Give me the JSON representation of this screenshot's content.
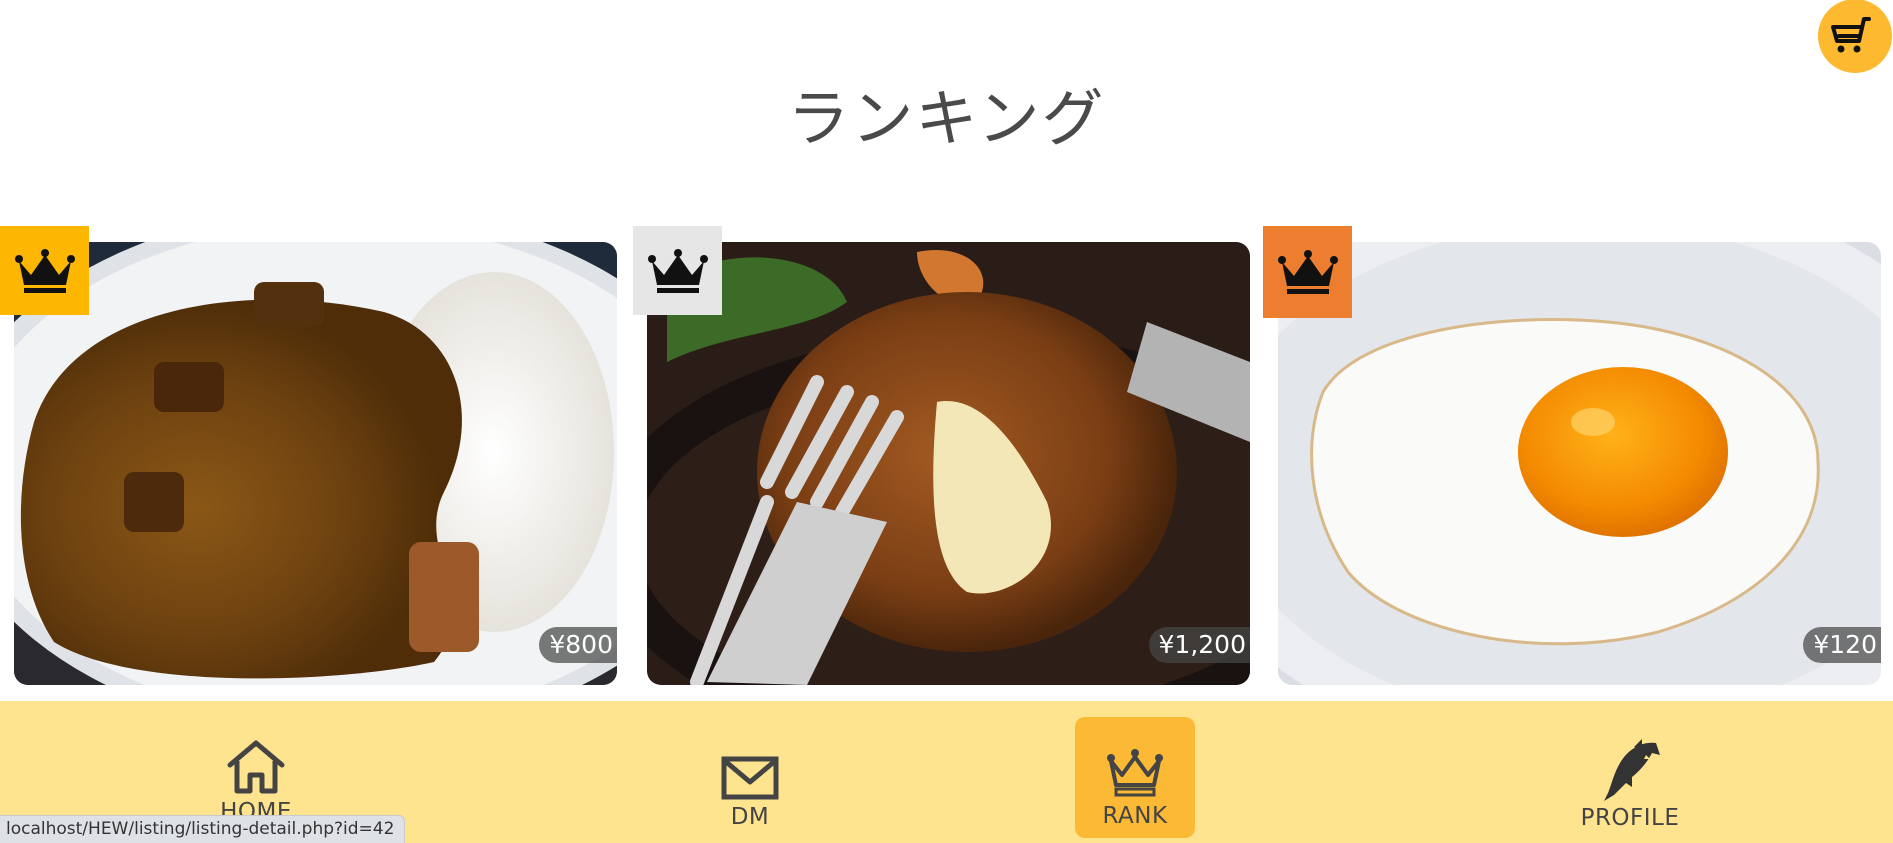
{
  "page": {
    "title": "ランキング"
  },
  "cart": {
    "icon": "cart-icon",
    "color": "#fdb92f"
  },
  "ranking": [
    {
      "rank": 1,
      "badge_color": "#fdb700",
      "item": "curry-rice",
      "price": "¥800"
    },
    {
      "rank": 2,
      "badge_color": "#e6e6e6",
      "item": "hamburg-steak",
      "price": "¥1,200"
    },
    {
      "rank": 3,
      "badge_color": "#ed7d2f",
      "item": "fried-egg",
      "price": "¥120"
    }
  ],
  "nav": {
    "background": "#ffe48f",
    "active_color": "#fcb935",
    "items": [
      {
        "label": "HOME",
        "icon": "home-icon"
      },
      {
        "label": "DM",
        "icon": "mail-icon"
      },
      {
        "label": "RANK",
        "icon": "crown-icon",
        "active": true
      },
      {
        "label": "PROFILE",
        "icon": "shark-icon"
      }
    ]
  },
  "status_url": "localhost/HEW/listing/listing-detail.php?id=42"
}
